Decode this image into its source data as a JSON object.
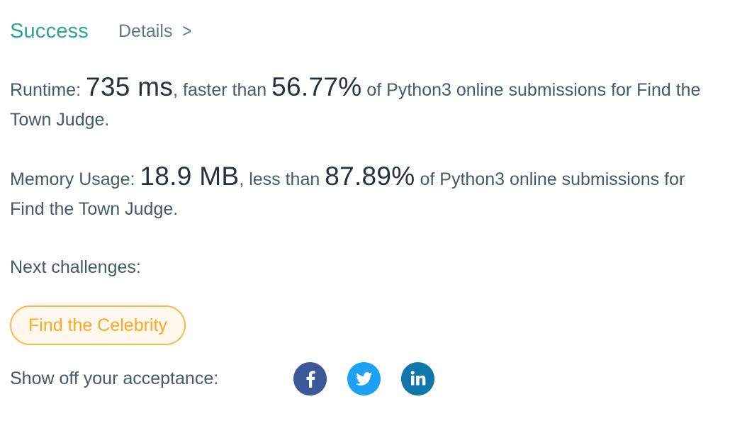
{
  "header": {
    "status": "Success",
    "details_label": "Details",
    "chevron": ">"
  },
  "runtime": {
    "label": "Runtime:",
    "value": "735 ms",
    "comparison": ", faster than",
    "percent": "56.77%",
    "suffix": "of Python3 online submissions for Find the Town Judge."
  },
  "memory": {
    "label": "Memory Usage:",
    "value": "18.9 MB",
    "comparison": ", less than",
    "percent": "87.89%",
    "suffix": "of Python3 online submissions for Find the Town Judge."
  },
  "next": {
    "label": "Next challenges:",
    "challenges": [
      "Find the Celebrity"
    ]
  },
  "share": {
    "label": "Show off your acceptance:",
    "icons": [
      "facebook-icon",
      "twitter-icon",
      "linkedin-icon"
    ]
  },
  "colors": {
    "success": "#2da58f",
    "challenge_border": "#ffb74d",
    "challenge_text": "#ffa726",
    "facebook": "#3b5998",
    "twitter": "#1da1f2",
    "linkedin": "#0e76a8"
  }
}
